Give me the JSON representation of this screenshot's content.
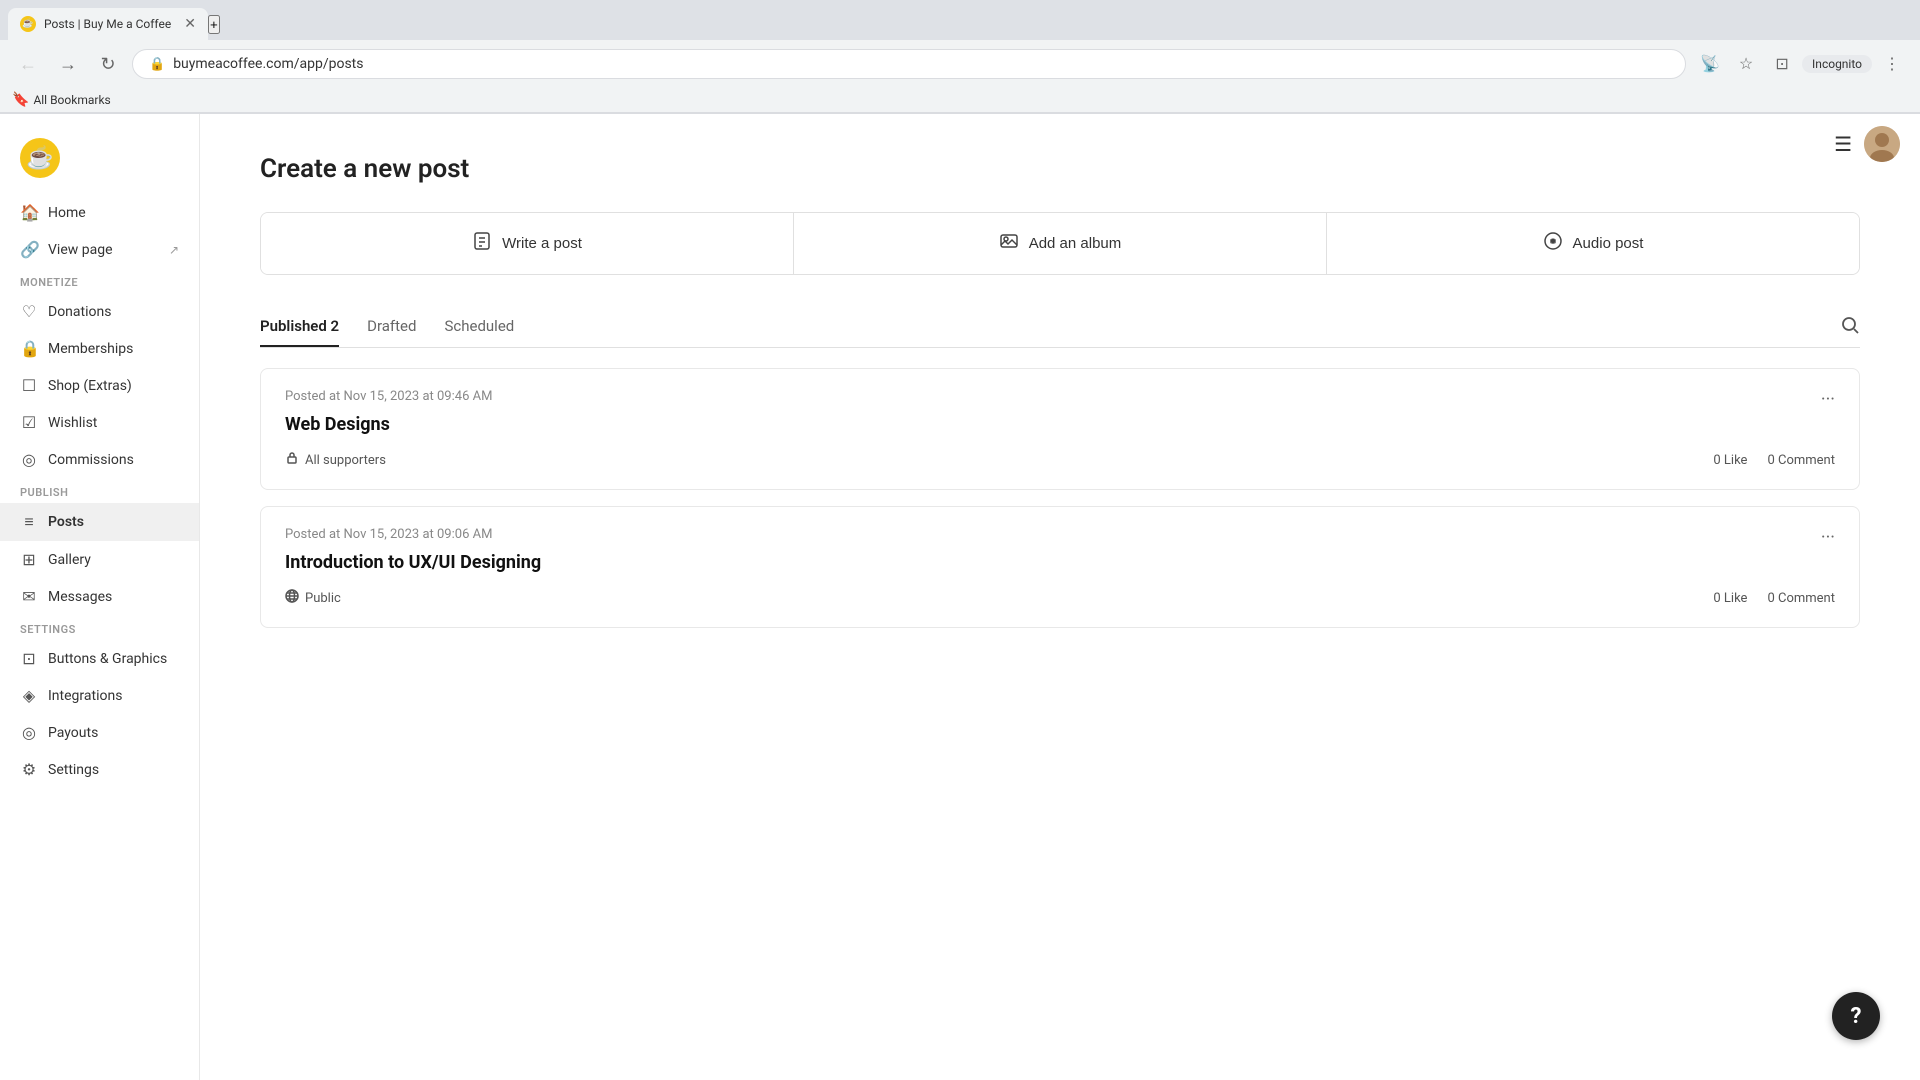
{
  "browser": {
    "tab_title": "Posts | Buy Me a Coffee",
    "tab_favicon": "☕",
    "url": "buymeacoffee.com/app/posts",
    "incognito_label": "Incognito",
    "bookmarks_label": "All Bookmarks"
  },
  "sidebar": {
    "logo_icon": "☕",
    "items": [
      {
        "id": "home",
        "label": "Home",
        "icon": "🏠"
      },
      {
        "id": "view-page",
        "label": "View page",
        "icon": "🔗",
        "external": true
      }
    ],
    "sections": [
      {
        "label": "MONETIZE",
        "items": [
          {
            "id": "donations",
            "label": "Donations",
            "icon": "♡"
          },
          {
            "id": "memberships",
            "label": "Memberships",
            "icon": "🔒"
          },
          {
            "id": "shop-extras",
            "label": "Shop (Extras)",
            "icon": "⊡"
          },
          {
            "id": "wishlist",
            "label": "Wishlist",
            "icon": "⊟"
          },
          {
            "id": "commissions",
            "label": "Commissions",
            "icon": "◎"
          }
        ]
      },
      {
        "label": "PUBLISH",
        "items": [
          {
            "id": "posts",
            "label": "Posts",
            "icon": "≡",
            "active": true
          },
          {
            "id": "gallery",
            "label": "Gallery",
            "icon": "⊞"
          },
          {
            "id": "messages",
            "label": "Messages",
            "icon": "✉"
          }
        ]
      },
      {
        "label": "SETTINGS",
        "items": [
          {
            "id": "buttons-graphics",
            "label": "Buttons & Graphics",
            "icon": "⊡"
          },
          {
            "id": "integrations",
            "label": "Integrations",
            "icon": "◈"
          },
          {
            "id": "payouts",
            "label": "Payouts",
            "icon": "◎"
          },
          {
            "id": "settings",
            "label": "Settings",
            "icon": "⚙"
          }
        ]
      }
    ]
  },
  "main": {
    "page_title": "Create a new post",
    "post_types": [
      {
        "id": "write-post",
        "label": "Write a post",
        "icon": "📄"
      },
      {
        "id": "add-album",
        "label": "Add an album",
        "icon": "🖼"
      },
      {
        "id": "audio-post",
        "label": "Audio post",
        "icon": "🎧"
      }
    ],
    "tabs": [
      {
        "id": "published",
        "label": "Published 2",
        "active": true
      },
      {
        "id": "drafted",
        "label": "Drafted",
        "active": false
      },
      {
        "id": "scheduled",
        "label": "Scheduled",
        "active": false
      }
    ],
    "posts": [
      {
        "id": "post-1",
        "meta": "Posted at Nov 15, 2023 at 09:46 AM",
        "title": "Web Designs",
        "access": "All supporters",
        "access_icon": "lock",
        "likes": "0 Like",
        "comments": "0 Comment"
      },
      {
        "id": "post-2",
        "meta": "Posted at Nov 15, 2023 at 09:06 AM",
        "title": "Introduction to UX/UI Designing",
        "access": "Public",
        "access_icon": "globe",
        "likes": "0 Like",
        "comments": "0 Comment"
      }
    ]
  },
  "help_label": "?"
}
